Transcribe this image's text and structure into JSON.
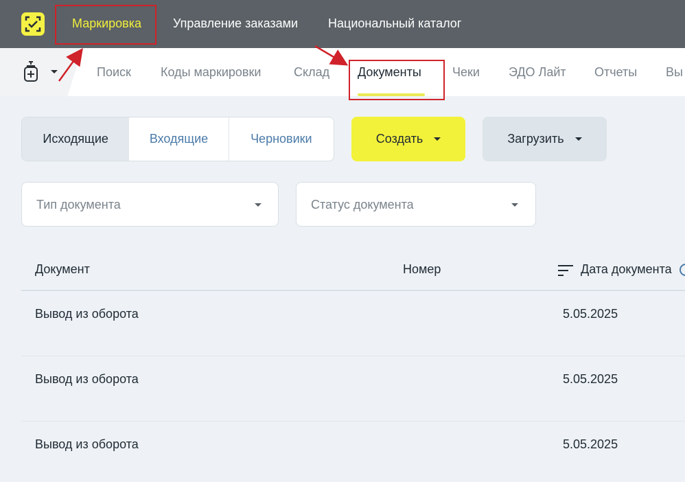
{
  "top_nav": {
    "items": [
      "Маркировка",
      "Управление заказами",
      "Национальный каталог"
    ]
  },
  "sub_nav": {
    "items": [
      "Поиск",
      "Коды маркировки",
      "Склад",
      "Документы",
      "Чеки",
      "ЭДО Лайт",
      "Отчеты",
      "Вы"
    ]
  },
  "doc_tabs": [
    "Исходящие",
    "Входящие",
    "Черновики"
  ],
  "actions": {
    "create": "Создать",
    "load": "Загрузить"
  },
  "filters": {
    "doc_type": "Тип документа",
    "doc_status": "Статус документа"
  },
  "table": {
    "headers": [
      "Документ",
      "Номер",
      "Дата документа"
    ],
    "rows": [
      {
        "document": "Вывод из оборота",
        "number": "",
        "date": "5.05.2025"
      },
      {
        "document": "Вывод из оборота",
        "number": "",
        "date": "5.05.2025"
      },
      {
        "document": "Вывод из оборота",
        "number": "",
        "date": "5.05.2025"
      }
    ]
  },
  "colors": {
    "top_bar": "#5b6166",
    "accent_yellow": "#f3f23a",
    "annotation_red": "#d0222a",
    "link_blue": "#4b7aa8"
  },
  "icons": [
    "app-logo-icon",
    "product-bottle-icon",
    "chevron-down-icon",
    "sort-icon",
    "help-icon"
  ]
}
